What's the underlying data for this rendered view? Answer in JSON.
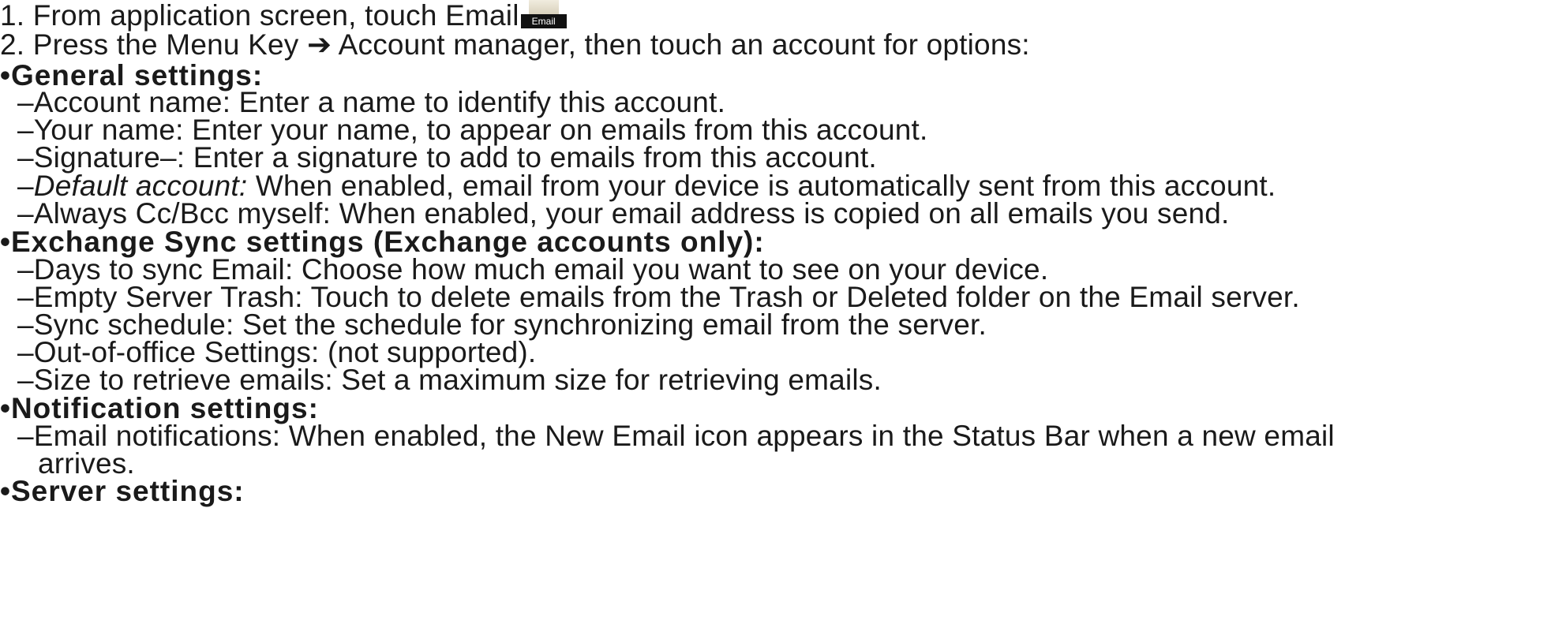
{
  "steps": [
    "1.  From application screen, touch Email",
    "2.  Press the Menu Key  ➔ Account manager, then touch an account for options:"
  ],
  "email_icon": {
    "icon": "email-app-icon",
    "label": "Email"
  },
  "general": {
    "heading": "•General settings:",
    "items": [
      "–Account name:  Enter a name to identify this account.",
      "–Your name:  Enter your name, to appear on emails from this account.",
      "–Signature–:  Enter a signature to add to emails from this account."
    ],
    "default_dash": "–",
    "default_label": "Default account:",
    "default_text": "  When enabled, email from your device is automatically sent from this account.",
    "always_cc": "–Always Cc/Bcc myself: When enabled, your email address is copied on all emails you send."
  },
  "exchange": {
    "heading": "•Exchange Sync settings (Exchange accounts only):",
    "items": [
      "–Days to sync Email:  Choose how much email you want to see on your device.",
      "–Empty Server Trash:  Touch to delete emails from the Trash or Deleted folder on the Email server.",
      "–Sync schedule:  Set the schedule for synchronizing email from the server.",
      "–Out-of-office Settings:  (not supported).",
      "–Size to retrieve emails:  Set a maximum size for retrieving emails."
    ]
  },
  "notification": {
    "heading": "•Notification settings:",
    "item_line1": "–Email notifications: When enabled, the New Email icon appears in the Status Bar when a new email",
    "item_line2": "arrives."
  },
  "server": {
    "heading": "•Server settings:"
  }
}
